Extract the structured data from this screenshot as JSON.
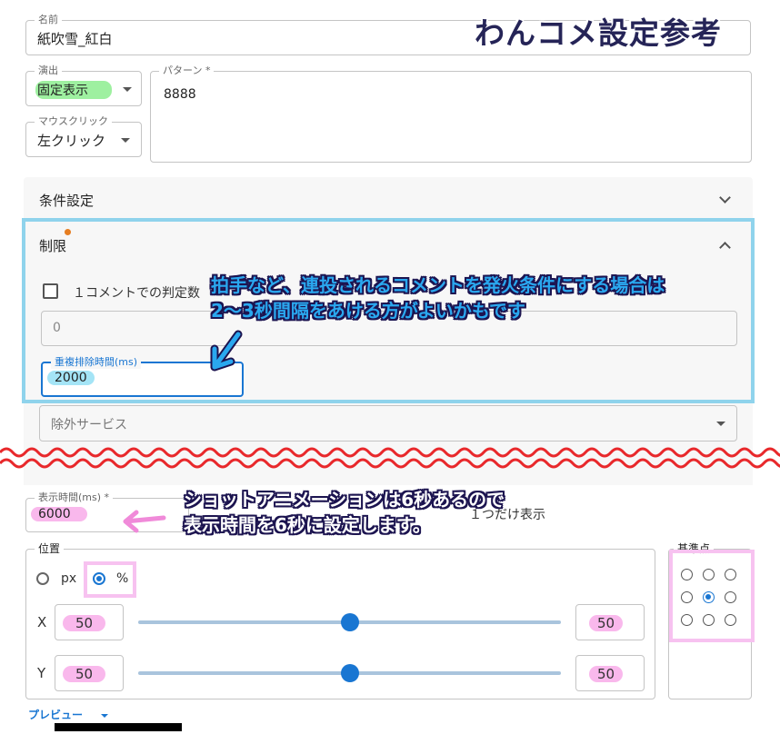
{
  "overlay_title": "わんコメ設定参考",
  "name_field": {
    "label": "名前",
    "value": "紙吹雪_紅白"
  },
  "effect_field": {
    "label": "演出",
    "value": "固定表示"
  },
  "mouse_field": {
    "label": "マウスクリック",
    "value": "左クリック"
  },
  "pattern_field": {
    "label": "パターン *",
    "value": "8888"
  },
  "conditions": {
    "title": "条件設定"
  },
  "limits": {
    "title": "制限",
    "checkbox_label": "１コメントでの判定数",
    "count_input_value": "0",
    "dedupe_label": "重複排除時間(ms)",
    "dedupe_value": "2000",
    "exclude_placeholder": "除外サービス"
  },
  "callout_1": {
    "line1": "拍手など、連投されるコメントを発火条件にする場合は",
    "line2": "2～3秒間隔をあける方がよいかもです"
  },
  "callout_2": {
    "line1": "ショットアニメーションは6秒あるので",
    "line2": "表示時間を6秒に設定します。"
  },
  "display_time": {
    "label": "表示時間(ms) *",
    "value": "6000"
  },
  "one_only_label": "１つだけ表示",
  "position": {
    "legend": "位置",
    "unit_px": "px",
    "unit_percent": "%",
    "selected_unit": "%",
    "x_label": "X",
    "x_value": "50",
    "x_slider_value": 50,
    "y_label": "Y",
    "y_value": "50",
    "y_slider_value": 50
  },
  "anchor": {
    "legend": "基準点",
    "selected": "center"
  },
  "preview_label": "プレビュー",
  "colors": {
    "accent": "#1976d2",
    "callout_frame": "#8fd3ec",
    "pink_highlight": "#f9b8ec",
    "green_highlight": "#9ef0a0"
  }
}
